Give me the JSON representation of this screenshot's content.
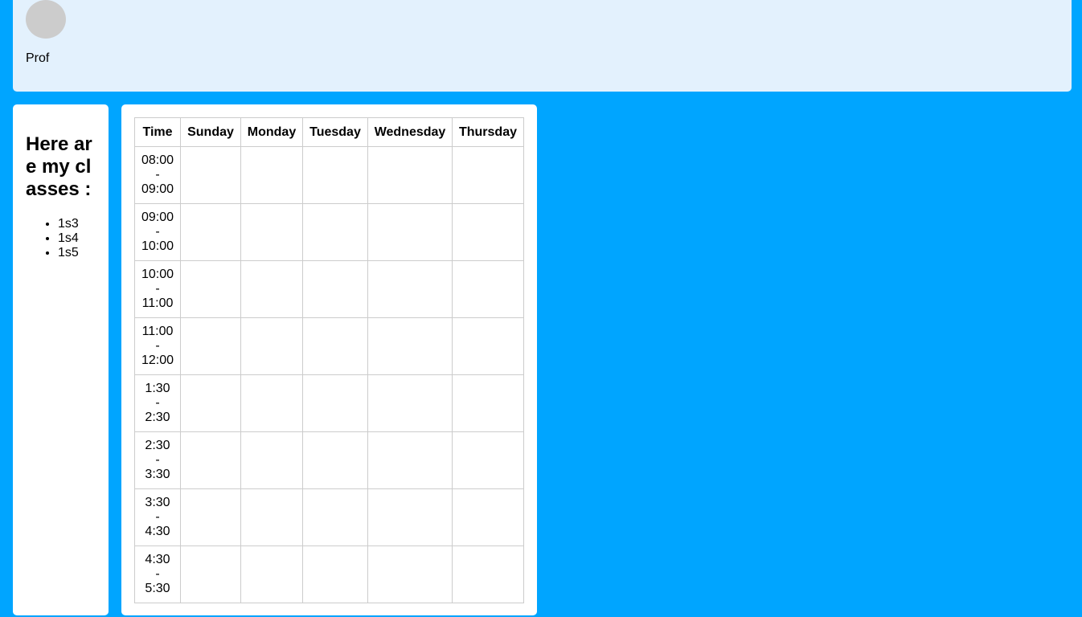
{
  "header": {
    "profile_name": "Prof"
  },
  "sidebar": {
    "heading": "Here are my classes :",
    "classes": [
      "1s3",
      "1s4",
      "1s5"
    ]
  },
  "timetable": {
    "columns": [
      "Time",
      "Sunday",
      "Monday",
      "Tuesday",
      "Wednesday",
      "Thursday"
    ],
    "rows": [
      {
        "start": "08:00",
        "sep": "-",
        "end": "09:00"
      },
      {
        "start": "09:00",
        "sep": "-",
        "end": "10:00"
      },
      {
        "start": "10:00",
        "sep": "-",
        "end": "11:00"
      },
      {
        "start": "11:00",
        "sep": "-",
        "end": "12:00"
      },
      {
        "start": "1:30",
        "sep": "-",
        "end": "2:30"
      },
      {
        "start": "2:30",
        "sep": "-",
        "end": "3:30"
      },
      {
        "start": "3:30",
        "sep": "-",
        "end": "4:30"
      },
      {
        "start": "4:30",
        "sep": "-",
        "end": "5:30"
      }
    ]
  }
}
